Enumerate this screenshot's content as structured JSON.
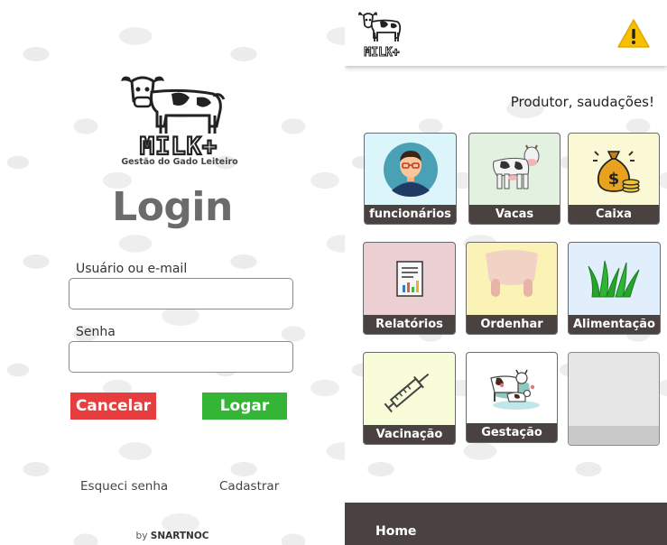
{
  "login": {
    "brand_tagline": "Gestão do Gado Leiteiro",
    "title": "Login",
    "username_label": "Usuário ou e-mail",
    "username_value": "",
    "password_label": "Senha",
    "password_value": "",
    "cancel_label": "Cancelar",
    "login_label": "Logar",
    "forgot_label": "Esqueci senha",
    "register_label": "Cadastrar",
    "byline_prefix": "by",
    "byline_brand": "SNARTNOC"
  },
  "dashboard": {
    "greeting": "Produtor, saudações!",
    "warning_icon": "warning-icon",
    "tiles": [
      {
        "label": "funcionários",
        "icon": "employee-avatar-icon",
        "bg": "#dcf5fa"
      },
      {
        "label": "Vacas",
        "icon": "cow-icon",
        "bg": "#e3f1e0"
      },
      {
        "label": "Caixa",
        "icon": "money-bag-icon",
        "bg": "#fbf8d6"
      },
      {
        "label": "Relatórios",
        "icon": "report-icon",
        "bg": "#ebcfd2"
      },
      {
        "label": "Ordenhar",
        "icon": "udder-icon",
        "bg": "#fbf3b5"
      },
      {
        "label": "Alimentação",
        "icon": "grass-icon",
        "bg": "#e1eefb"
      },
      {
        "label": "Vacinação",
        "icon": "syringe-icon",
        "bg": "#f8fcd9"
      },
      {
        "label": "Gestação",
        "icon": "cow-calf-icon",
        "bg": "#ffffff"
      },
      {
        "label": "",
        "icon": "",
        "bg": "#e6e6e6"
      }
    ],
    "nav_home": "Home"
  },
  "colors": {
    "cancel": "#e63e3e",
    "login": "#35b535",
    "caption_bar": "#4a4141",
    "title_gray": "#6b6b6b"
  }
}
